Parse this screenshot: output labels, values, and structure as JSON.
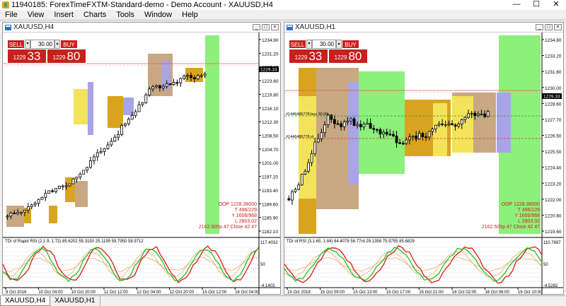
{
  "app": {
    "title": "11940185: ForexTimeFXTM-Standard-demo - Demo Account - XAUUSD,H4"
  },
  "menu": [
    "File",
    "View",
    "Insert",
    "Charts",
    "Tools",
    "Window",
    "Help"
  ],
  "window_controls": {
    "minimize": "—",
    "maximize": "☐",
    "close": "✕"
  },
  "charts": [
    {
      "title": "XAUUSD,H4",
      "one_click": {
        "sell": "SELL",
        "buy": "BUY",
        "lot": "30.00",
        "bid_small": "1229",
        "bid_big": "33",
        "ask_small": "1229",
        "ask_big": "80"
      },
      "price_labels": [
        "1234.90",
        "1231.20",
        "1227.40",
        "1223.60",
        "1219.80",
        "1216.10",
        "1212.30",
        "1208.50",
        "1204.70",
        "1201.00",
        "1197.20",
        "1193.40",
        "1189.60",
        "1185.90",
        "1182.10"
      ],
      "current_price": "1229.33",
      "info": [
        "OOP 1228.38000",
        "T 496/229",
        "Y 1606/968",
        "L 2803.02",
        "2162.505p 47 Close 42 47"
      ],
      "indicator": {
        "title": "TDI of Rapid RSI (2,1.9, 1.72) 85.6202 55.3150 25.1199 59.7950 58.9712",
        "labels": [
          "117.4032",
          "50",
          "-4.1403"
        ]
      },
      "time_labels": [
        "9 Oct 2018",
        "10 Oct 04:00",
        "10 Oct 20:00",
        "11 Oct 12:00",
        "12 Oct 04:00",
        "12 Oct 20:00",
        "15 Oct 12:00",
        "16 Oct 04:00"
      ],
      "tf": "H4"
    },
    {
      "title": "XAUUSD,H1",
      "one_click": {
        "sell": "SELL",
        "buy": "BUY",
        "lot": "30.00",
        "bid_small": "1229",
        "bid_big": "33",
        "ask_small": "1229",
        "ask_big": "80"
      },
      "price_labels": [
        "1234.80",
        "1233.20",
        "1231.60",
        "1230.00",
        "1228.60",
        "1227.70",
        "1226.50",
        "1225.50",
        "1224.40",
        "1223.20",
        "1222.00",
        "1220.80",
        "1219.60"
      ],
      "current_price": "1229.33",
      "info": [
        "OOP 1228.38000",
        "T 496/229",
        "Y 1606/968",
        "L 2803.02",
        "2162.505p 47 Close 42 47"
      ],
      "order_lines": [
        "#1446486778 buy 30.00",
        "#1446486778 sl"
      ],
      "indicator": {
        "title": "TDI of RSI (3,1.65, 1.84) 84.4078 56.77rd 29.1358 75.9755 85.6829",
        "labels": [
          "110.7697",
          "50",
          "-4.5282"
        ]
      },
      "time_labels": [
        "15 Oct 2018",
        "15 Oct 09:00",
        "15 Oct 13:00",
        "15 Oct 17:00",
        "15 Oct 21:00",
        "16 Oct 02:00",
        "16 Oct 06:00",
        "16 Oct 10:00"
      ],
      "tf": "H1"
    }
  ],
  "tabs": [
    "XAUUSD,H4",
    "XAUUSD,H1"
  ],
  "colors": {
    "bull": "#ffffff",
    "bear": "#000000",
    "green_zone": "#8cf07a",
    "tan_zone": "#c8a882",
    "gold_zone": "#d9a520",
    "yellow_zone": "#f3e35a",
    "lavender_zone": "#a9a3e8",
    "sell_red": "#c8201c",
    "info_red": "#d02020",
    "rsi_green": "#1cc21c",
    "rsi_red": "#e01818",
    "band_orange": "#e0a060"
  }
}
